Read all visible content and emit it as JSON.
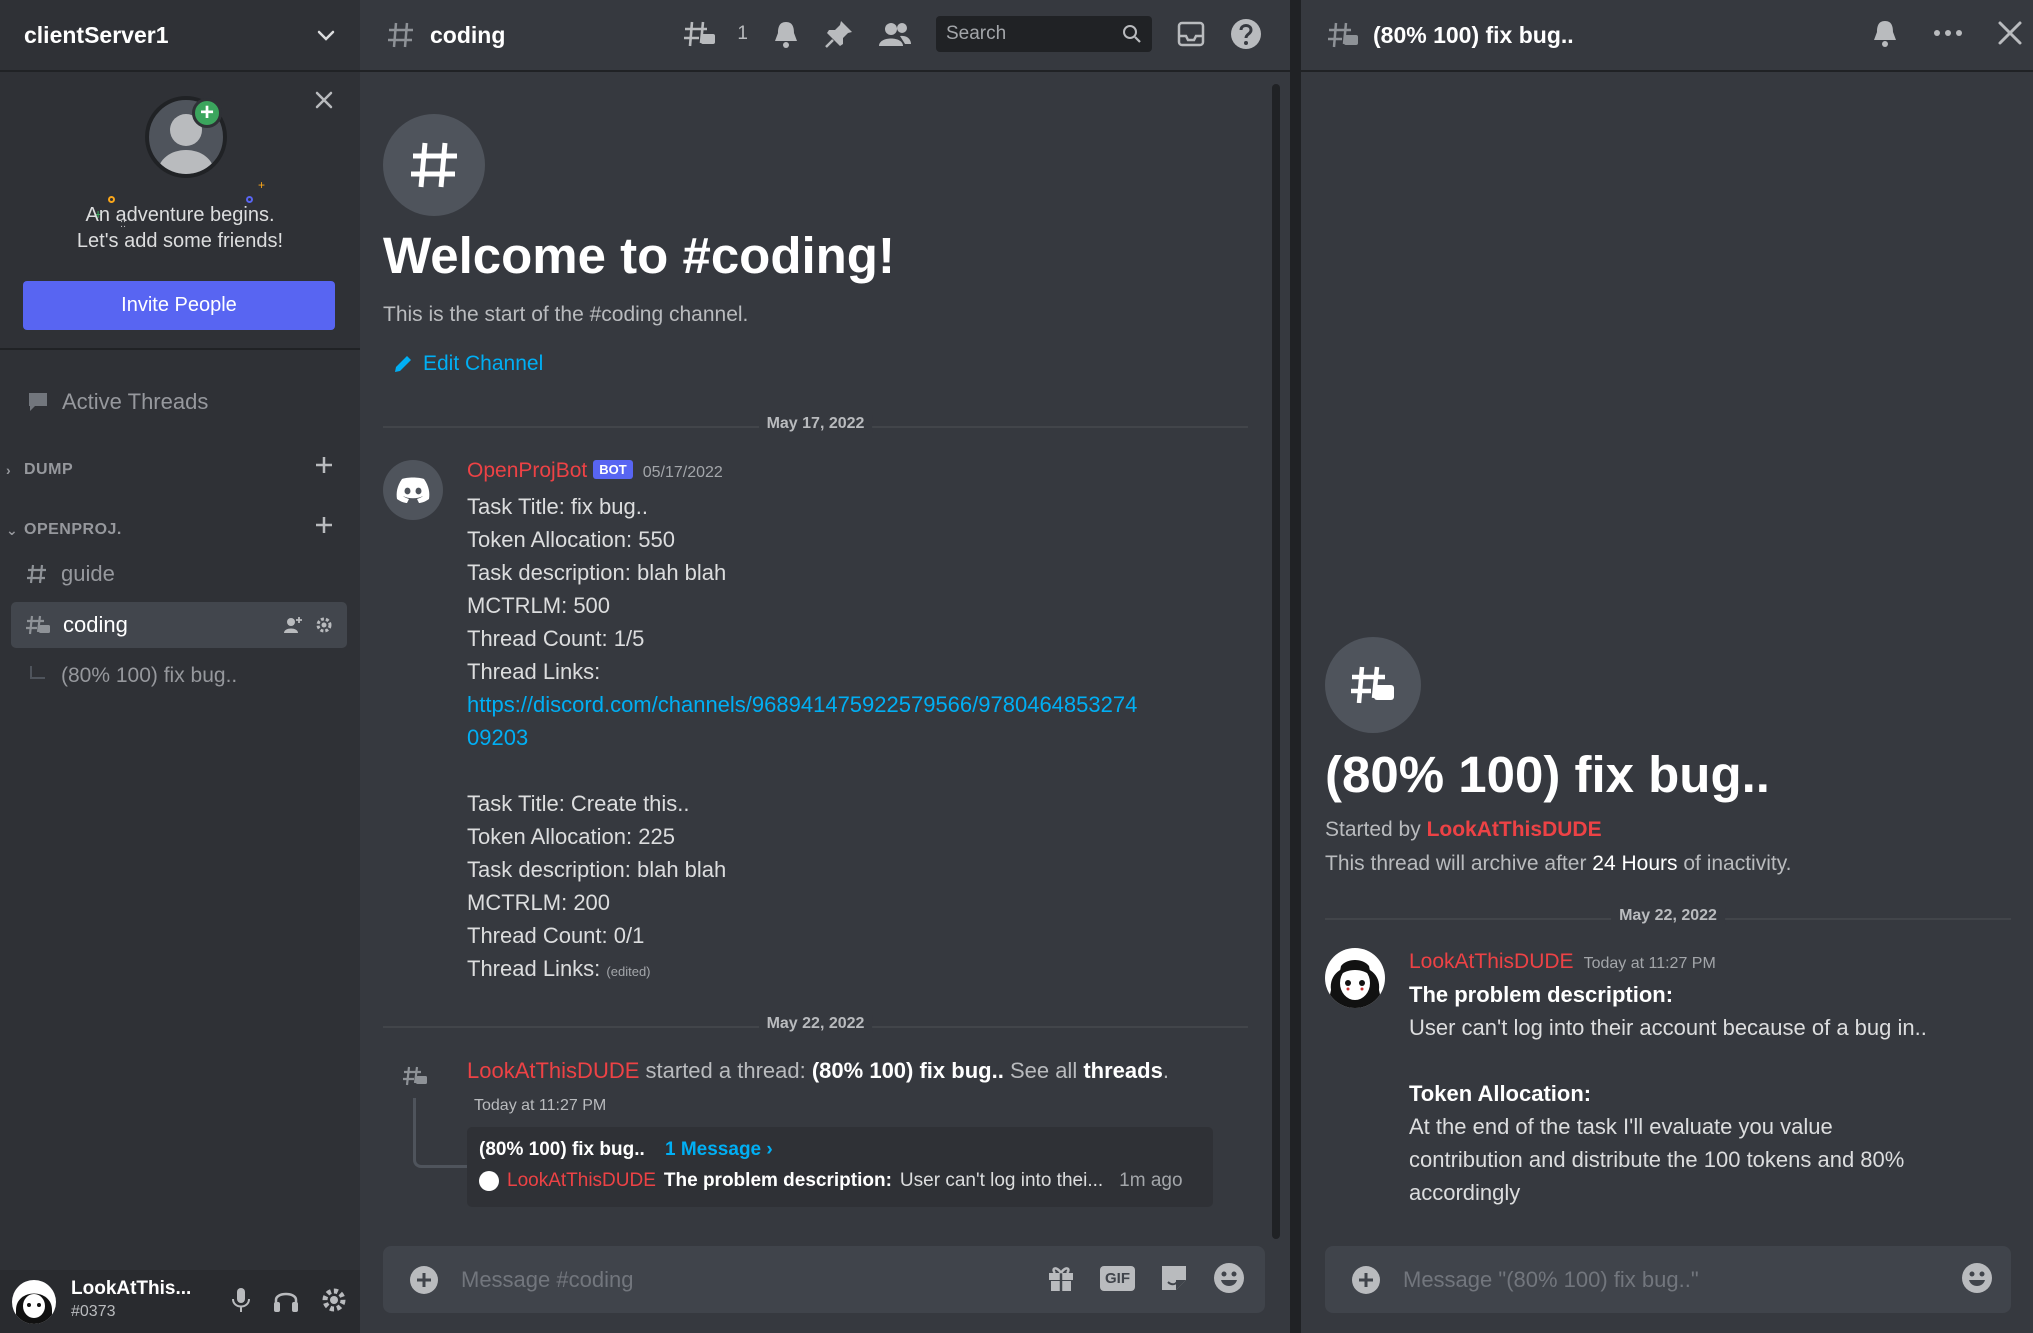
{
  "server": {
    "name": "clientServer1"
  },
  "invite": {
    "line1": "An adventure begins.",
    "line2": "Let's add some friends!",
    "button": "Invite People"
  },
  "sidebar": {
    "active_threads": "Active Threads",
    "categories": [
      {
        "label": "DUMP",
        "collapsed": true
      },
      {
        "label": "OPENPROJ.",
        "collapsed": false
      }
    ],
    "channels": [
      {
        "label": "guide"
      },
      {
        "label": "coding",
        "selected": true
      },
      {
        "label": "(80% 100) fix bug..",
        "is_thread": true
      }
    ]
  },
  "user": {
    "name": "LookAtThis...",
    "tag": "#0373",
    "status": "online"
  },
  "main": {
    "channel": "coding",
    "thread_count": "1",
    "search_placeholder": "Search",
    "welcome_title": "Welcome to #coding!",
    "welcome_sub": "This is the start of the #coding channel.",
    "edit_channel": "Edit Channel",
    "divider1": "May 17, 2022",
    "divider2": "May 22, 2022",
    "bot_message": {
      "author": "OpenProjBot",
      "tag": "BOT",
      "timestamp": "05/17/2022",
      "lines": [
        "Task Title: fix bug..",
        "Token Allocation: 550",
        "Task description: blah blah",
        "MCTRLM: 500",
        "Thread Count: 1/5",
        "Thread Links:"
      ],
      "link_line1": "https://discord.com/channels/968941475922579566/9780464853274",
      "link_line2": "09203",
      "lines2": [
        "Task Title: Create this..",
        "Token Allocation: 225",
        "Task description: blah blah",
        "MCTRLM: 200",
        "Thread Count: 0/1",
        "Thread Links:"
      ],
      "edited": "(edited)"
    },
    "thread_system": {
      "author": "LookAtThisDUDE",
      "text1": "started a thread:",
      "thread_name": "(80% 100) fix bug..",
      "text2": "See all",
      "threads_link": "threads",
      "period": ".",
      "timestamp": "Today at 11:27 PM"
    },
    "thread_card": {
      "title": "(80% 100) fix bug..",
      "count": "1 Message ›",
      "author": "LookAtThisDUDE",
      "bold": "The problem description:",
      "preview": "User can't log into thei...",
      "ago": "1m ago"
    },
    "composer_placeholder": "Message #coding"
  },
  "thread": {
    "title": "(80% 100) fix bug..",
    "started_by_label": "Started by",
    "started_by": "LookAtThisDUDE",
    "archive_pre": "This thread will archive after",
    "archive_hl": "24 Hours",
    "archive_post": "of inactivity.",
    "divider": "May 22, 2022",
    "message": {
      "author": "LookAtThisDUDE",
      "timestamp": "Today at 11:27 PM",
      "h1": "The problem description:",
      "p1": "User can't log into their account because of a bug in..",
      "h2": "Token Allocation:",
      "p2a": "At the end of the task I'll evaluate you value",
      "p2b": "contribution and distribute the 100 tokens and 80%",
      "p2c": "accordingly"
    },
    "composer_placeholder": "Message \"(80% 100) fix bug..\""
  },
  "colors": {
    "accent": "#5865f2",
    "link": "#00aff4",
    "author_red": "#ed4245",
    "online": "#3ba55d"
  }
}
